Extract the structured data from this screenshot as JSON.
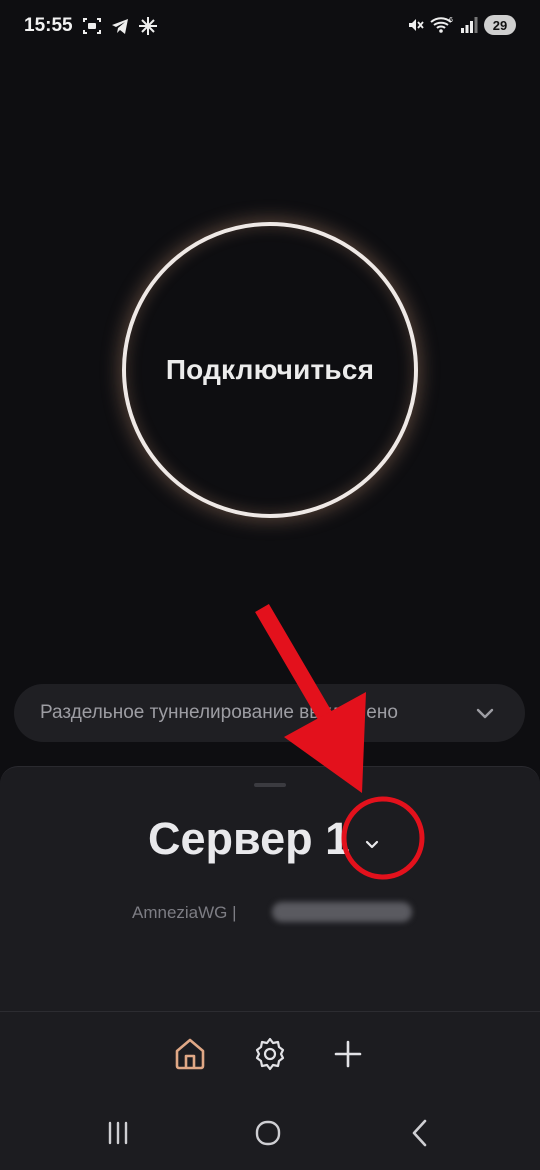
{
  "status_bar": {
    "time": "15:55",
    "battery": "29",
    "network_badge": "6"
  },
  "connect": {
    "label": "Подключиться"
  },
  "split_tunneling": {
    "label": "Раздельное туннелирование выключено"
  },
  "server": {
    "name": "Сервер 1",
    "protocol": "AmneziaWG |",
    "address_hidden": true
  },
  "tabs": [
    {
      "id": "home",
      "icon": "home-icon",
      "active": true
    },
    {
      "id": "settings",
      "icon": "gear-icon",
      "active": false
    },
    {
      "id": "add",
      "icon": "plus-icon",
      "active": false
    }
  ],
  "nav": [
    {
      "id": "recents",
      "icon": "recents-icon"
    },
    {
      "id": "home",
      "icon": "home-circle-icon"
    },
    {
      "id": "back",
      "icon": "back-icon"
    }
  ],
  "colors": {
    "background": "#0e0e11",
    "sheet": "#1c1c20",
    "ring": "#efe9e6",
    "ring_glow": "#d6a07d",
    "accent_home_tab": "#e0a886",
    "annotation_red": "#e3111c"
  }
}
